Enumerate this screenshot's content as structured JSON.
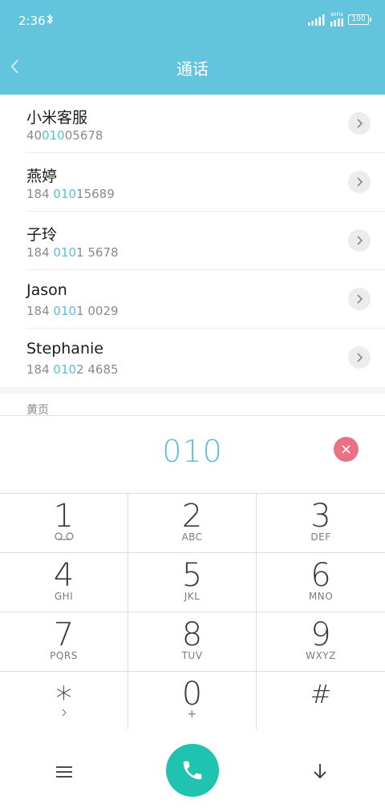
{
  "status": {
    "time": "2:36",
    "wifi_label": "WiFi4",
    "battery": "100"
  },
  "header": {
    "title": "通话"
  },
  "contacts": [
    {
      "name": "小米客服",
      "num_pre": "40",
      "num_hl": "010",
      "num_post": "05678"
    },
    {
      "name": "燕婷",
      "num_pre": "184 ",
      "num_hl": "010",
      "num_post": "15689"
    },
    {
      "name": "子玲",
      "num_pre": "184 ",
      "num_hl": "010",
      "num_post": "1 5678"
    },
    {
      "name": "Jason",
      "num_pre": "184 ",
      "num_hl": "010",
      "num_post": "1 0029"
    },
    {
      "name": "Stephanie",
      "num_pre": "184 ",
      "num_hl": "010",
      "num_post": "2 4685"
    }
  ],
  "yellow_pages": {
    "label": "黄页"
  },
  "display": {
    "digits": "010"
  },
  "keypad": [
    {
      "digit": "1",
      "letters": ""
    },
    {
      "digit": "2",
      "letters": "ABC"
    },
    {
      "digit": "3",
      "letters": "DEF"
    },
    {
      "digit": "4",
      "letters": "GHI"
    },
    {
      "digit": "5",
      "letters": "JKL"
    },
    {
      "digit": "6",
      "letters": "MNO"
    },
    {
      "digit": "7",
      "letters": "PQRS"
    },
    {
      "digit": "8",
      "letters": "TUV"
    },
    {
      "digit": "9",
      "letters": "WXYZ"
    },
    {
      "digit": "*",
      "letters": ""
    },
    {
      "digit": "0",
      "letters": "+"
    },
    {
      "digit": "#",
      "letters": ""
    }
  ],
  "colors": {
    "header": "#63c4de",
    "highlight": "#58c0d8",
    "delete": "#ea7086",
    "call": "#1fc3b0"
  },
  "icons": {
    "back": "chevron-left-icon",
    "chevron": "chevron-right-icon",
    "delete": "close-icon",
    "voicemail": "voicemail-icon",
    "menu": "menu-icon",
    "call": "phone-icon",
    "collapse": "arrow-down-icon"
  }
}
